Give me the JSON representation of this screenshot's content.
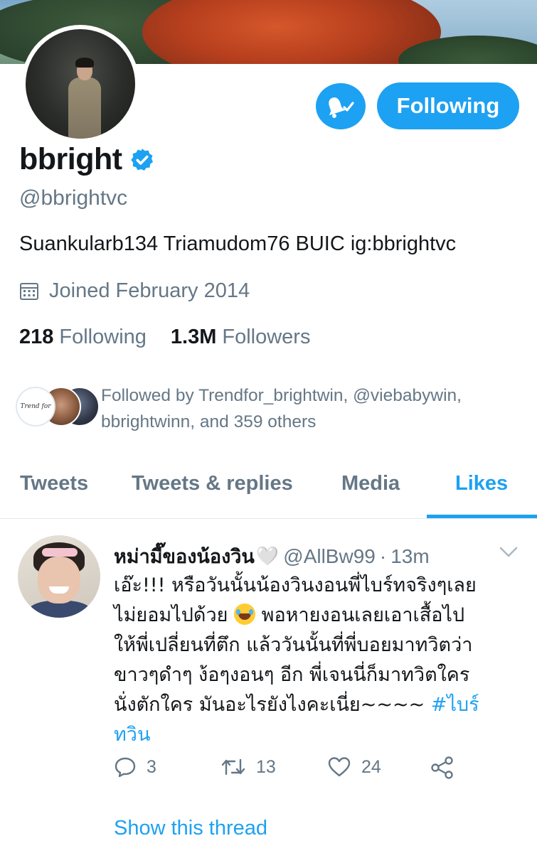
{
  "profile": {
    "display_name": "bbright",
    "handle": "@bbrightvc",
    "bio": "Suankularb134 Triamudom76 BUIC ig:bbrightvc",
    "joined": "Joined February 2014",
    "following_count": "218",
    "following_label": "Following",
    "followers_count": "1.3M",
    "followers_label": "Followers",
    "verified": true
  },
  "actions": {
    "follow_button_label": "Following",
    "notifications_icon": "bell-check-icon"
  },
  "followed_by": {
    "text_line1": "Followed by Trendfor_brightwin, @viebabywin,",
    "text_line2": "bbrightwinn, and 359 others",
    "first_avatar_text": "Trend for"
  },
  "tabs": [
    {
      "label": "Tweets",
      "active": false
    },
    {
      "label": "Tweets & replies",
      "active": false
    },
    {
      "label": "Media",
      "active": false
    },
    {
      "label": "Likes",
      "active": true
    }
  ],
  "tweet": {
    "author_name": "หม่ามี๊ของน้องวิน",
    "author_heart": "🤍",
    "author_handle": "@AllBw99",
    "dot": "·",
    "time": "13m",
    "lines": [
      "เอ๊ะ!!! หรือวันนั้นน้องวินงอนพี่ไบร์ทจริงๆเลย",
      "ไม่ยอมไปด้วย",
      "พอหายงอนเลยเอาเสื้อไป",
      "ให้พี่เปลี่ยนที่ตึก แล้ววันนั้นที่พี่บอยมาทวิตว่า",
      "ขาวๆดำๆ ง้อๆงอนๆ อีก พี่เจนนี่ก็มาทวิตใคร",
      "นั่งตักใคร มันอะไรยังไงคะเนี่ย~~~~",
      "#ไบร์",
      "ทวิน"
    ],
    "reply_count": "3",
    "retweet_count": "13",
    "like_count": "24",
    "show_thread_label": "Show this thread"
  },
  "colors": {
    "accent": "#1da1f2",
    "text_primary": "#14171a",
    "text_secondary": "#657786",
    "divider": "#e1e8ed"
  }
}
